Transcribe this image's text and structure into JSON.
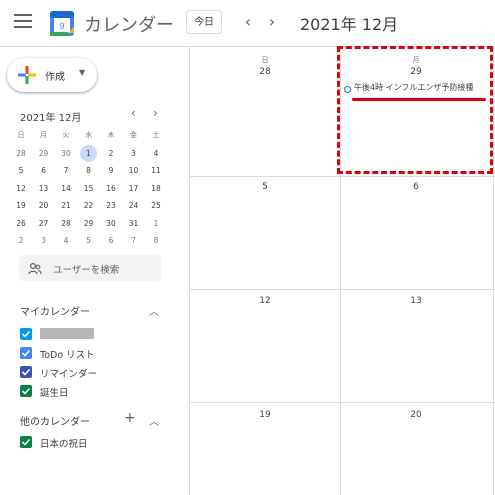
{
  "header": {
    "app_title": "カレンダー",
    "logo_day": "9",
    "today_label": "今日",
    "prev_label": "‹",
    "next_label": "›",
    "month_title": "2021年 12月"
  },
  "sidebar": {
    "create_label": "作成",
    "mini_calendar": {
      "title": "2021年 12月",
      "prev_label": "‹",
      "next_label": "›",
      "weekdays": [
        "日",
        "月",
        "火",
        "水",
        "木",
        "金",
        "土"
      ],
      "weeks": [
        [
          "28",
          "29",
          "30",
          "1",
          "2",
          "3",
          "4"
        ],
        [
          "5",
          "6",
          "7",
          "8",
          "9",
          "10",
          "11"
        ],
        [
          "12",
          "13",
          "14",
          "15",
          "16",
          "17",
          "18"
        ],
        [
          "19",
          "20",
          "21",
          "22",
          "23",
          "24",
          "25"
        ],
        [
          "26",
          "27",
          "28",
          "29",
          "30",
          "31",
          "1"
        ],
        [
          "2",
          "3",
          "4",
          "5",
          "6",
          "7",
          "8"
        ]
      ],
      "today": "1"
    },
    "search_placeholder": "ユーザーを検索",
    "my_calendars": {
      "title": "マイカレンダー",
      "items": [
        {
          "label": "",
          "color": "#039be5",
          "redacted": true
        },
        {
          "label": "ToDo リスト",
          "color": "#4285f4"
        },
        {
          "label": "リマインダー",
          "color": "#3f51b5"
        },
        {
          "label": "誕生日",
          "color": "#0b8043"
        }
      ]
    },
    "other_calendars": {
      "title": "他のカレンダー",
      "add_label": "+",
      "items": [
        {
          "label": "日本の祝日",
          "color": "#0b8043"
        }
      ]
    }
  },
  "grid": {
    "weekdays": [
      "日",
      "月"
    ],
    "rows": [
      [
        "28",
        "29"
      ],
      [
        "5",
        "6"
      ],
      [
        "12",
        "13"
      ],
      [
        "19",
        "20"
      ]
    ],
    "event": {
      "day": "29",
      "text": "午後4時 インフルエンザ予防接種",
      "color": "#1a73e8"
    }
  },
  "annotation": {
    "color": "#e0000b"
  }
}
